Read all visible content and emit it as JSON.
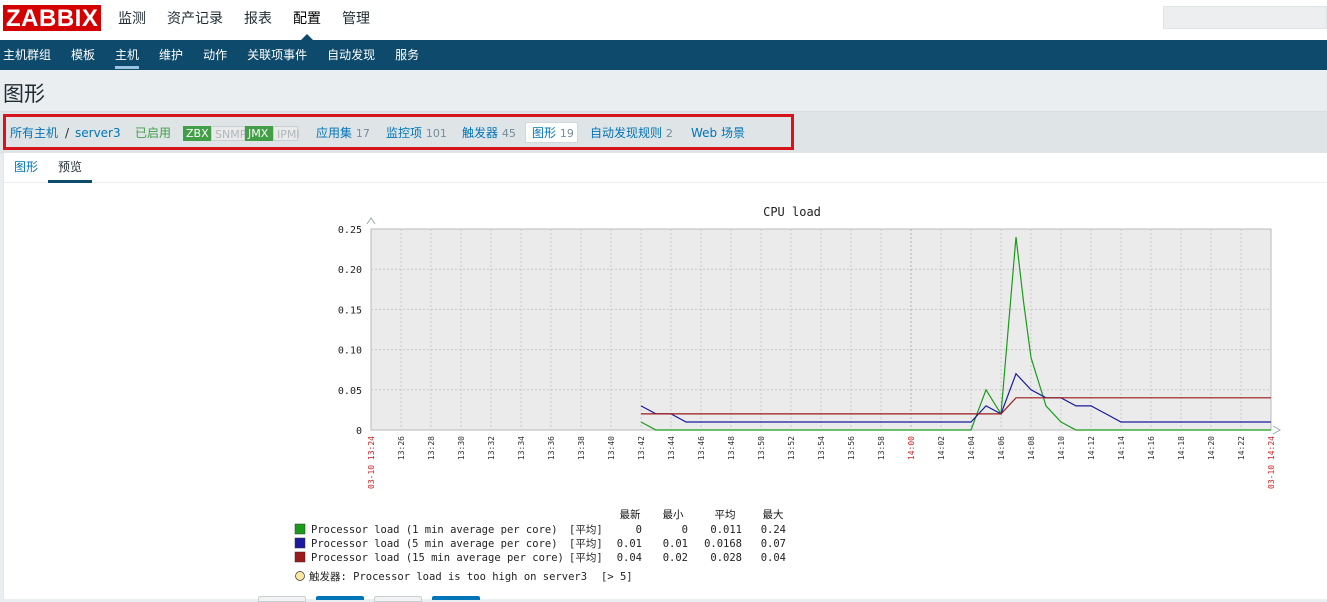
{
  "header": {
    "logo": "ZABBIX",
    "nav": [
      "监测",
      "资产记录",
      "报表",
      "配置",
      "管理"
    ],
    "active_nav": "配置"
  },
  "subnav": {
    "items": [
      "主机群组",
      "模板",
      "主机",
      "维护",
      "动作",
      "关联项事件",
      "自动发现",
      "服务"
    ],
    "active": "主机"
  },
  "page_title": "图形",
  "host_nav": {
    "all_hosts": "所有主机",
    "separator": "/",
    "host": "server3",
    "status": "已启用",
    "availability": [
      {
        "label": "ZBX",
        "state": "on"
      },
      {
        "label": "SNMP",
        "state": "off"
      },
      {
        "label": "JMX",
        "state": "on"
      },
      {
        "label": "IPMI",
        "state": "off"
      }
    ],
    "applications": {
      "label": "应用集",
      "count": "17"
    },
    "items": {
      "label": "监控项",
      "count": "101"
    },
    "triggers": {
      "label": "触发器",
      "count": "45"
    },
    "graphs": {
      "label": "图形",
      "count": "19"
    },
    "discovery": {
      "label": "自动发现规则",
      "count": "2"
    },
    "web": {
      "label": "Web 场景"
    }
  },
  "tabs": {
    "graph": "图形",
    "preview": "预览",
    "active": "预览"
  },
  "chart_data": {
    "type": "line",
    "title": "CPU load",
    "ylim": [
      0,
      0.25
    ],
    "y_ticks": [
      "0",
      "0.05",
      "0.10",
      "0.15",
      "0.20",
      "0.25"
    ],
    "x_ticks": [
      "13:26",
      "13:28",
      "13:30",
      "13:32",
      "13:34",
      "13:36",
      "13:38",
      "13:40",
      "13:42",
      "13:44",
      "13:46",
      "13:48",
      "13:50",
      "13:52",
      "13:54",
      "13:56",
      "13:58",
      "14:00",
      "14:02",
      "14:04",
      "14:06",
      "14:08",
      "14:10",
      "14:12",
      "14:14",
      "14:16",
      "14:18",
      "14:20",
      "14:22"
    ],
    "x_start_label": "03-10 13:24",
    "x_end_label": "03-10 14:24",
    "grid": true,
    "legend_headers": [
      "最新",
      "最小",
      "平均",
      "最大"
    ],
    "series": [
      {
        "name": "Processor load (1 min average per core)",
        "color": "#1a9c1a",
        "func": "[平均]",
        "stats": [
          "0",
          "0",
          "0.011",
          "0.24"
        ],
        "x": [
          "13:42",
          "13:43",
          "13:44",
          "14:04",
          "14:05",
          "14:06",
          "14:07",
          "14:07.5",
          "14:08",
          "14:09",
          "14:10",
          "14:11",
          "14:12",
          "14:24"
        ],
        "values": [
          0.01,
          0,
          0,
          0,
          0.05,
          0.02,
          0.24,
          0.16,
          0.09,
          0.03,
          0.01,
          0,
          0,
          0
        ]
      },
      {
        "name": "Processor load (5 min average per core)",
        "color": "#1a1aa0",
        "func": "[平均]",
        "stats": [
          "0.01",
          "0.01",
          "0.0168",
          "0.07"
        ],
        "x": [
          "13:42",
          "13:43",
          "13:44",
          "13:45",
          "14:04",
          "14:05",
          "14:06",
          "14:07",
          "14:08",
          "14:09",
          "14:10",
          "14:11",
          "14:12",
          "14:13",
          "14:14",
          "14:24"
        ],
        "values": [
          0.03,
          0.02,
          0.02,
          0.01,
          0.01,
          0.03,
          0.02,
          0.07,
          0.05,
          0.04,
          0.04,
          0.03,
          0.03,
          0.02,
          0.01,
          0.01
        ]
      },
      {
        "name": "Processor load (15 min average per core)",
        "color": "#9c1a1a",
        "func": "[平均]",
        "stats": [
          "0.04",
          "0.02",
          "0.028",
          "0.04"
        ],
        "x": [
          "13:42",
          "14:06",
          "14:07",
          "14:24"
        ],
        "values": [
          0.02,
          0.02,
          0.04,
          0.04
        ]
      }
    ],
    "trigger": {
      "label": "触发器:",
      "text": "Processor load is too high on server3",
      "threshold": "[> 5]"
    }
  }
}
